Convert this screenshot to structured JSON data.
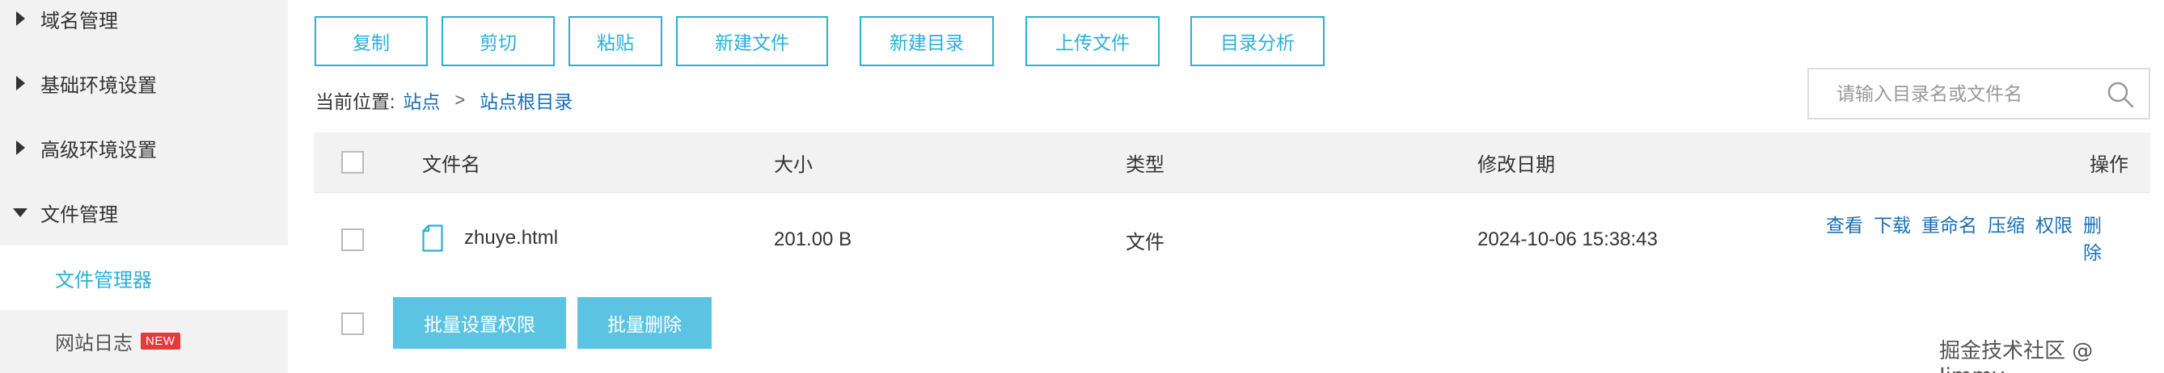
{
  "sidebar": {
    "items": [
      {
        "label": "域名管理",
        "expanded": false
      },
      {
        "label": "基础环境设置",
        "expanded": false
      },
      {
        "label": "高级环境设置",
        "expanded": false
      },
      {
        "label": "文件管理",
        "expanded": true
      }
    ],
    "sub_items": [
      {
        "label": "文件管理器",
        "active": true
      },
      {
        "label": "网站日志",
        "badge": "NEW"
      }
    ]
  },
  "toolbar": {
    "copy": "复制",
    "cut": "剪切",
    "paste": "粘贴",
    "new_file": "新建文件",
    "new_dir": "新建目录",
    "upload": "上传文件",
    "dir_analysis": "目录分析"
  },
  "breadcrumb": {
    "prefix": "当前位置:",
    "items": [
      "站点",
      "站点根目录"
    ],
    "separator": ">"
  },
  "search": {
    "placeholder": "请输入目录名或文件名",
    "icon": "search-icon"
  },
  "table": {
    "headers": [
      "文件名",
      "大小",
      "类型",
      "修改日期",
      "操作"
    ],
    "rows": [
      {
        "name": "zhuye.html",
        "size": "201.00 B",
        "type": "文件",
        "modified": "2024-10-06 15:38:43",
        "icon": "file-icon",
        "actions": [
          "查看",
          "下载",
          "重命名",
          "压缩",
          "权限",
          "删除"
        ]
      }
    ]
  },
  "batch": {
    "set_permissions": "批量设置权限",
    "delete": "批量删除"
  },
  "watermark": "掘金技术社区 @ Jimmy",
  "colors": {
    "accent": "#2ab0d6",
    "link": "#1a6fb5",
    "batch_button": "#5bc4e2",
    "badge": "#e33a3a",
    "sidebar_bg": "#f2f2f2",
    "header_bg": "#f2f2f2"
  }
}
